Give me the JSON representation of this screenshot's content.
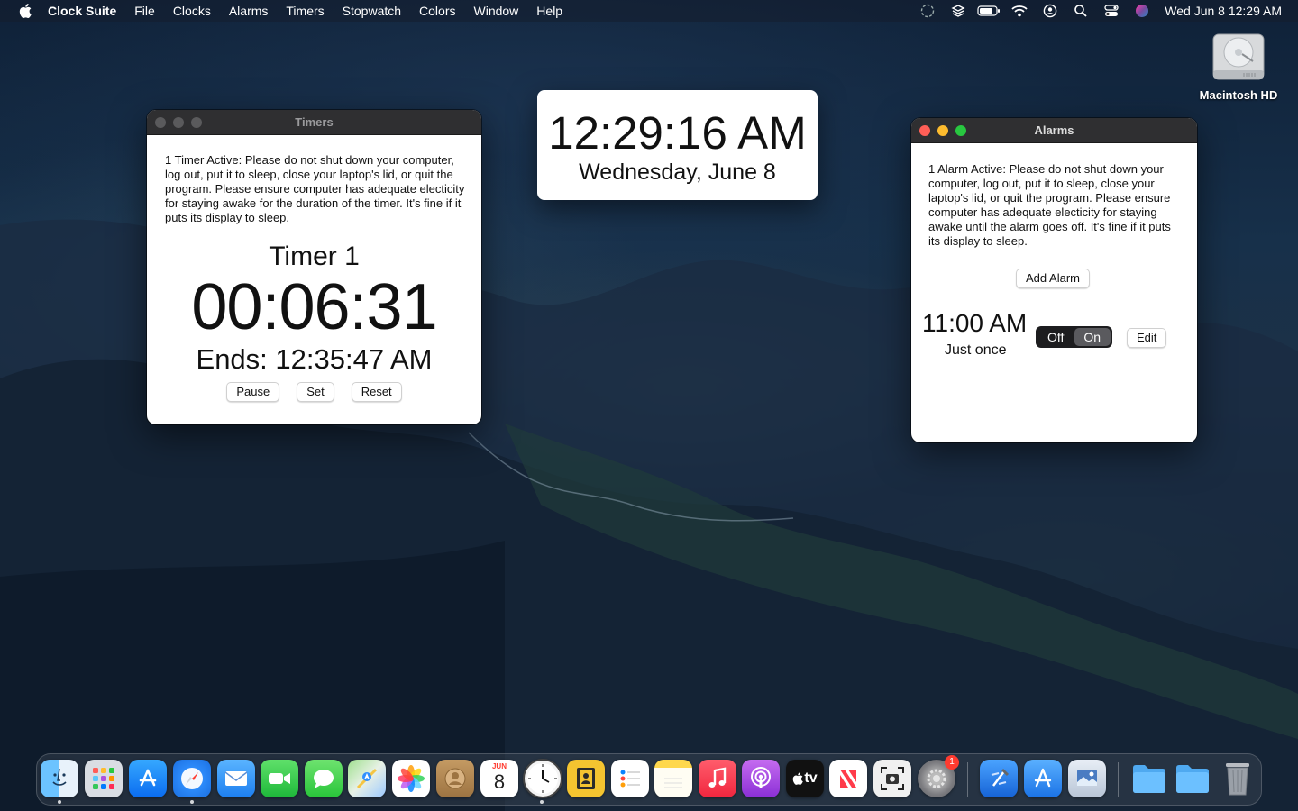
{
  "menubar": {
    "app_name": "Clock Suite",
    "menus": [
      "File",
      "Clocks",
      "Alarms",
      "Timers",
      "Stopwatch",
      "Colors",
      "Window",
      "Help"
    ],
    "datetime": "Wed Jun 8  12:29 AM",
    "status_icons": [
      "focus-moon-icon",
      "layers-icon",
      "battery-icon",
      "wifi-icon",
      "user-account-icon",
      "spotlight-search-icon",
      "control-center-icon",
      "siri-icon"
    ]
  },
  "desktop": {
    "disk_label": "Macintosh HD"
  },
  "timers_window": {
    "title": "Timers",
    "notice": "1 Timer Active: Please do not shut down your computer, log out, put it to sleep, close your laptop's lid, or quit the program.  Please ensure computer has adequate electicity for staying awake for the duration of the timer.  It's fine if it puts its display to sleep.",
    "timer_name": "Timer 1",
    "countdown": "00:06:31",
    "ends": "Ends: 12:35:47 AM",
    "buttons": {
      "pause": "Pause",
      "set": "Set",
      "reset": "Reset"
    }
  },
  "clock_widget": {
    "time": "12:29:16 AM",
    "date": "Wednesday, June 8"
  },
  "alarms_window": {
    "title": "Alarms",
    "notice": "1 Alarm Active: Please do not shut down your computer, log out, put it to sleep, close your laptop's lid, or quit the program.  Please ensure computer has adequate electicity for staying awake until the alarm goes off.  It's fine if it puts its display to sleep.",
    "add_button": "Add Alarm",
    "alarm": {
      "time": "11:00 AM",
      "repeat": "Just once",
      "toggle_off": "Off",
      "toggle_on": "On",
      "selected": "On",
      "edit": "Edit"
    }
  },
  "dock": {
    "calendar_month": "JUN",
    "calendar_day": "8",
    "tv_label": "tv",
    "settings_badge": "1",
    "apps": [
      "Finder",
      "Launchpad",
      "App Store",
      "Safari",
      "Mail",
      "FaceTime",
      "Messages",
      "Maps",
      "Photos",
      "Contacts",
      "Calendar",
      "Clock Suite",
      "Address Book",
      "Reminders",
      "Notes",
      "Music",
      "Podcasts",
      "TV",
      "News",
      "Screenshot",
      "System Preferences",
      "Xcode",
      "Simulator",
      "Preview",
      "Folder",
      "Downloads",
      "Trash"
    ]
  },
  "colors": {
    "red": "#ff5f57",
    "yellow": "#febc2e",
    "green": "#28c840",
    "badge": "#ff3b30"
  }
}
